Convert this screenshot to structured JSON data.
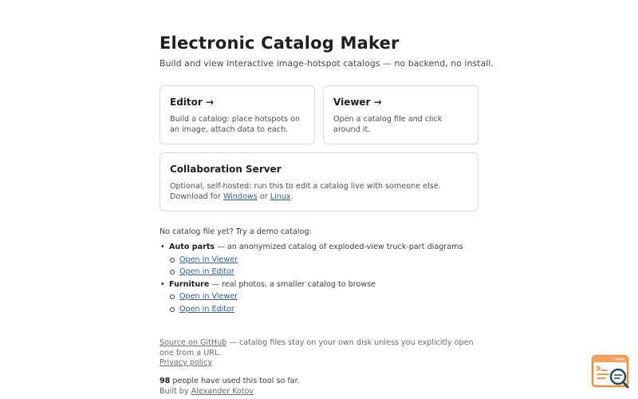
{
  "header": {
    "title": "Electronic Catalog Maker",
    "subtitle": "Build and view interactive image-hotspot catalogs — no backend, no install."
  },
  "cards": {
    "editor": {
      "title": "Editor →",
      "description": "Build a catalog: place hotspots on an image, attach data to each."
    },
    "viewer": {
      "title": "Viewer →",
      "description": "Open a catalog file and click around it."
    },
    "server": {
      "title": "Collaboration Server",
      "description_prefix": "Optional, self-hosted: run this to edit a catalog live with someone else. Download for ",
      "windows_link": "Windows",
      "or_text": " or ",
      "linux_link": "Linux",
      "suffix": "."
    }
  },
  "demos": {
    "intro": "No catalog file yet? Try a demo catalog:",
    "items": [
      {
        "name": "Auto parts",
        "description": " — an anonymized catalog of exploded-view truck-part diagrams",
        "viewer_link": "Open in Viewer",
        "editor_link": "Open in Editor"
      },
      {
        "name": "Furniture",
        "description": " — real photos, a smaller catalog to browse",
        "viewer_link": "Open in Viewer",
        "editor_link": "Open in Editor"
      }
    ]
  },
  "footer": {
    "source_link": "Source on GitHub",
    "source_text": " — catalog files stay on your own disk unless you explicitly open one from a URL.",
    "privacy_link": "Privacy policy",
    "usage_count": "98",
    "usage_text": " people have used this tool so far.",
    "built_by_prefix": "Built by ",
    "author_link": "Alexander Kotov"
  },
  "icons": {
    "feedback": "search-feedback-icon"
  },
  "colors": {
    "link": "#2a5db0",
    "widget_accent": "#f08c3a",
    "widget_teal": "#1f4f57"
  }
}
